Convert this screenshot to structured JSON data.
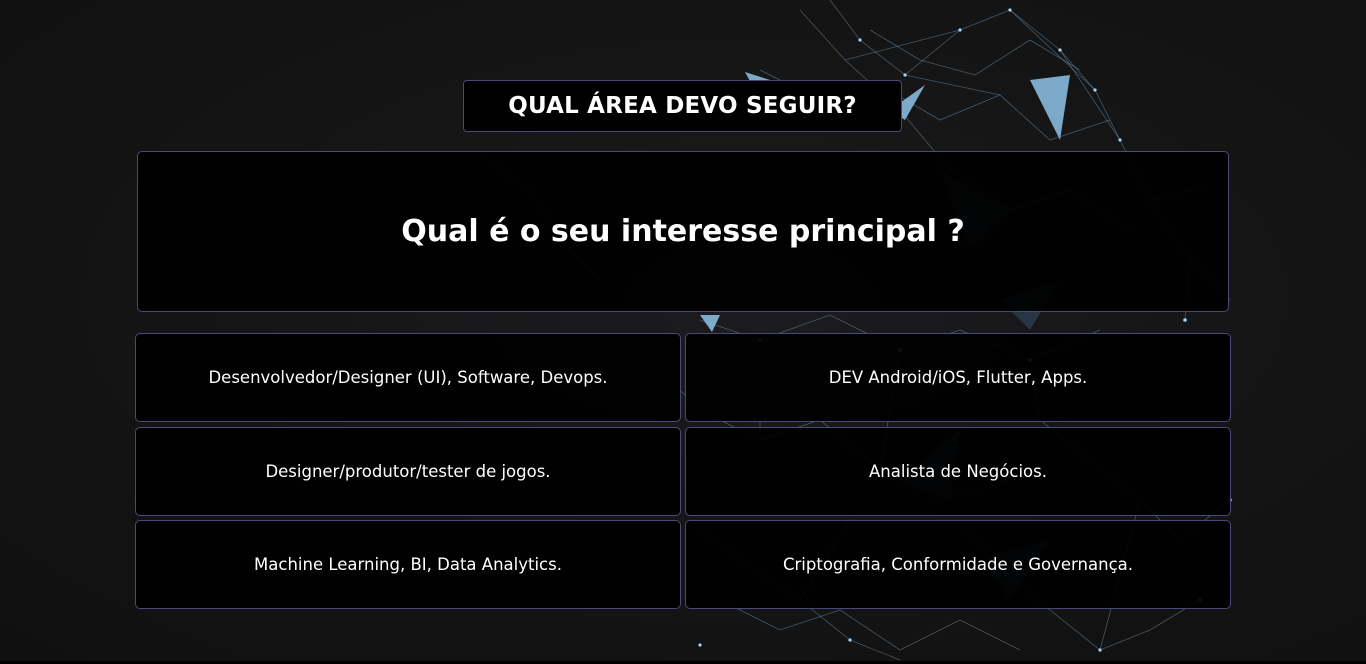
{
  "header": {
    "title": "QUAL ÁREA DEVO SEGUIR?"
  },
  "question": {
    "text": "Qual é o seu interesse principal ?"
  },
  "options": [
    {
      "label": "Desenvolvedor/Designer (UI), Software, Devops."
    },
    {
      "label": "DEV Android/iOS, Flutter, Apps."
    },
    {
      "label": "Designer/produtor/tester de jogos."
    },
    {
      "label": "Analista de Negócios."
    },
    {
      "label": "Machine Learning, BI, Data Analytics."
    },
    {
      "label": "Criptografia, Conformidade e Governança."
    }
  ],
  "colors": {
    "background": "#151515",
    "box": "#000000",
    "border": "#4a4a7a",
    "network_accent": "#8ec3e8"
  }
}
